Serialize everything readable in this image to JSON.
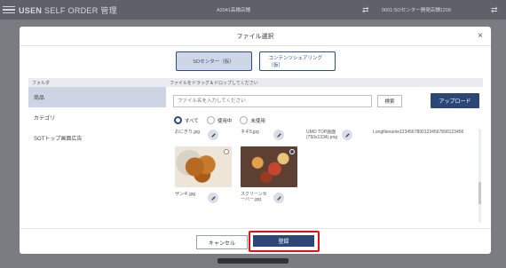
{
  "app": {
    "title_brand": "USEN",
    "title_rest": " SELF ORDER 管理",
    "store": "A3041高橋店舗",
    "terminal": "0001:SOセンター開発店舗1209"
  },
  "modal": {
    "title": "ファイル選択",
    "close": "×",
    "tabs": [
      {
        "label": "SOセンター（仮）",
        "active": true
      },
      {
        "label": "コンテンツシェアリング（仮）",
        "active": false
      }
    ],
    "folder_header": "フォルダ",
    "drop_header": "ファイルをドラッグ＆ドロップしてください",
    "folders": [
      {
        "label": "商品",
        "selected": true
      },
      {
        "label": "カテゴリ",
        "selected": false
      },
      {
        "label": "SOTトップ画面広告",
        "selected": false
      }
    ],
    "search": {
      "placeholder": "ファイル名を入力してください",
      "button": "検索",
      "upload": "アップロード"
    },
    "filters": [
      {
        "label": "すべて",
        "checked": true
      },
      {
        "label": "使用中",
        "checked": false
      },
      {
        "label": "未使用",
        "checked": false
      }
    ],
    "files_row1": [
      {
        "name": "おにぎり.jpg"
      },
      {
        "name": "ネギ5.jpg"
      },
      {
        "name": "UMO TOP画面\n(750x1334).png"
      },
      {
        "name": "Longfilename12345678901234567890123456"
      }
    ],
    "files_row2": [
      {
        "name": "ザンギ.jpg",
        "image": "karaage"
      },
      {
        "name": "スクリーンセ\nーバー.jpg",
        "image": "scroll"
      }
    ],
    "cancel": "キャンセル",
    "register": "登録"
  },
  "colors": {
    "primary": "#2c4777",
    "highlight": "#e3101a",
    "selected_folder": "#cdd5e5"
  }
}
